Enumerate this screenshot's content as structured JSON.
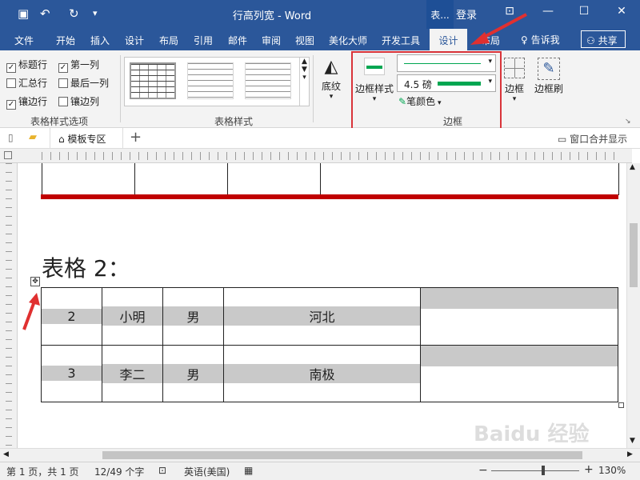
{
  "quick_access": {
    "save": "save-icon",
    "undo": "↶",
    "redo": "↻",
    "more": "⌅"
  },
  "title": {
    "doc": "行高列宽  -  Word",
    "context": "表...",
    "login": "登录"
  },
  "menu": {
    "file": "文件",
    "home": "开始",
    "insert": "插入",
    "design": "设计",
    "layout": "布局",
    "references": "引用",
    "mailings": "邮件",
    "review": "审阅",
    "view": "视图",
    "beautify": "美化大师",
    "developer": "开发工具",
    "table_design": "设计",
    "table_layout": "布局",
    "tell": "告诉我",
    "share": "共享"
  },
  "ribbon": {
    "options": {
      "header_row": "标题行",
      "total_row": "汇总行",
      "banded_rows": "镶边行",
      "first_col": "第一列",
      "last_col": "最后一列",
      "banded_cols": "镶边列",
      "group": "表格样式选项"
    },
    "styles_group": "表格样式",
    "shading": "底纹",
    "border_styles": "边框样式",
    "weight": "4.5 磅",
    "pen_color": "笔颜色",
    "borders": "边框",
    "border_painter": "边框刷",
    "borders_group": "边框",
    "accent": "#00a651"
  },
  "nav": {
    "template": "模板专区",
    "window_merge": "窗口合并显示"
  },
  "document": {
    "heading": "表格 2：",
    "rows": [
      {
        "no": "2",
        "name": "小明",
        "sex": "男",
        "place": "河北"
      },
      {
        "no": "3",
        "name": "李二",
        "sex": "男",
        "place": "南极"
      }
    ]
  },
  "status": {
    "page": "第 1 页，共 1 页",
    "words": "12/49 个字",
    "lang": "英语(美国)",
    "zoom": "130%"
  },
  "colors": {
    "titlebar": "#2b579a",
    "highlight": "#d9343a",
    "rule": "#c00000"
  },
  "watermark": "Baidu 经验"
}
